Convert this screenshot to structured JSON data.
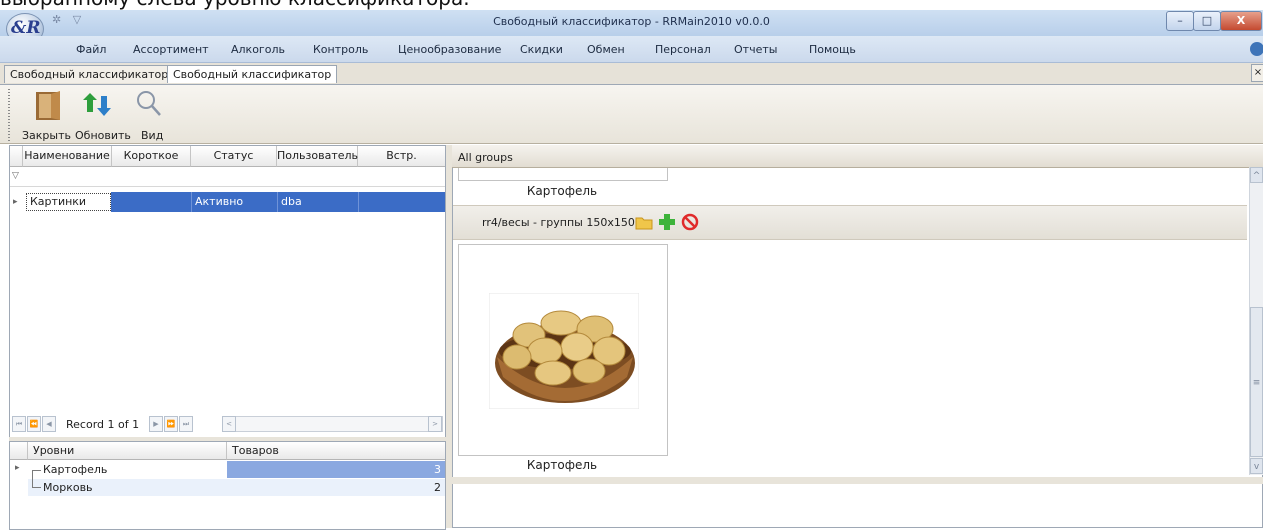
{
  "caption": "выбранному слева уровню классификатора.",
  "window": {
    "title": "Свободный классификатор - RRMain2010 v0.0.0",
    "logo_text": "&R",
    "quick_access": "✲ ▽",
    "min_glyph": "–",
    "max_glyph": "□",
    "close_glyph": "X"
  },
  "menu": [
    "Файл",
    "Ассортимент",
    "Алкоголь",
    "Контроль",
    "Ценообразование",
    "Скидки",
    "Обмен",
    "Персонал",
    "Отчеты",
    "Помощь"
  ],
  "tabs": [
    "Свободный классификатор",
    "Свободный классификатор"
  ],
  "tab_close_glyph": "×",
  "toolbar": {
    "buttons": [
      {
        "label": "Закрыть",
        "icon": "door-icon"
      },
      {
        "label": "Обновить",
        "icon": "refresh-arrows-icon"
      },
      {
        "label": "Вид",
        "icon": "magnifier-icon"
      }
    ]
  },
  "grid": {
    "columns": [
      "Наименование",
      "Короткое",
      "Статус",
      "Пользователь",
      "Встр."
    ],
    "filter_glyph": "▽",
    "row_indicator": "▸",
    "rows": [
      {
        "name": "Картинки",
        "short": "",
        "status": "Активно",
        "user": "dba",
        "builtin": ""
      }
    ],
    "navigator": {
      "record_text": "Record 1 of 1",
      "first": "⏮",
      "prev_page": "⏪",
      "prev": "◀",
      "next": "▶",
      "next_page": "⏩",
      "last": "⏭",
      "scroll_left": "<",
      "scroll_right": ">"
    }
  },
  "levels": {
    "columns": [
      "Уровни",
      "Товаров"
    ],
    "rows": [
      {
        "name": "Картофель",
        "count": "3",
        "selected": true
      },
      {
        "name": "Морковь",
        "count": "2",
        "selected": false
      }
    ],
    "row_indicator": "▸"
  },
  "gallery": {
    "header": "All groups",
    "top_label": "Картофель",
    "group_title": "rr4/весы - группы 150x150",
    "card_label": "Картофель",
    "scroll_up": "^",
    "scroll_down": "v",
    "grip": "≡"
  },
  "colors": {
    "selection": "#3b6cc6",
    "level_selection": "#8aa8e0",
    "titlebar": "#c4d6ee"
  }
}
